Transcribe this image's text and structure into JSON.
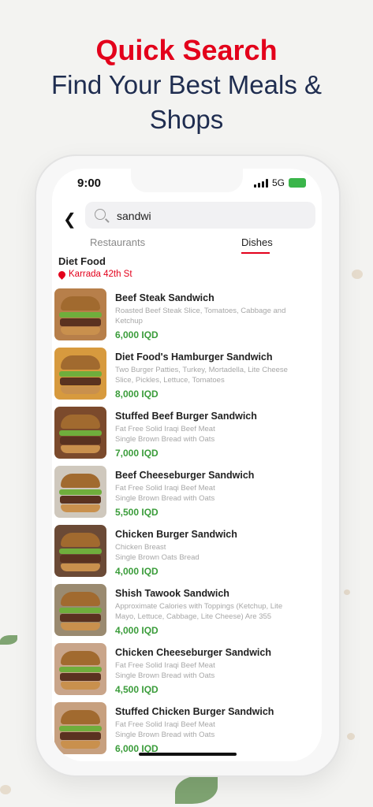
{
  "headline": {
    "accent": "Quick Search",
    "line1": "Find Your Best Meals &",
    "line2": "Shops"
  },
  "status_bar": {
    "time": "9:00",
    "network": "5G"
  },
  "search": {
    "value": "sandwi"
  },
  "tabs": [
    {
      "label": "Restaurants",
      "active": false
    },
    {
      "label": "Dishes",
      "active": true
    }
  ],
  "restaurant": {
    "name": "Diet Food",
    "location": "Karrada 42th St"
  },
  "items": [
    {
      "name": "Beef Steak Sandwich",
      "desc1": "Roasted Beef Steak Slice, Tomatoes, Cabbage and",
      "desc2": "Ketchup",
      "price": "6,000 IQD",
      "color": "#b77f4a"
    },
    {
      "name": "Diet Food's Hamburger Sandwich",
      "desc1": "Two Burger Patties, Turkey, Mortadella, Lite Cheese",
      "desc2": "Slice, Pickles, Lettuce, Tomatoes",
      "price": "8,000 IQD",
      "color": "#d79a3e"
    },
    {
      "name": "Stuffed Beef Burger Sandwich",
      "desc1": "Fat Free Solid Iraqi Beef Meat",
      "desc2": "Single Brown Bread with Oats",
      "price": "7,000 IQD",
      "color": "#7b4a2c"
    },
    {
      "name": "Beef Cheeseburger Sandwich",
      "desc1": "Fat Free Solid Iraqi Beef Meat",
      "desc2": "Single Brown Bread with Oats",
      "price": "5,500 IQD",
      "color": "#cfc8bd"
    },
    {
      "name": "Chicken Burger Sandwich",
      "desc1": "Chicken Breast",
      "desc2": "Single Brown Oats Bread",
      "price": "4,000 IQD",
      "color": "#6b4a36"
    },
    {
      "name": "Shish Tawook Sandwich",
      "desc1": "Approximate Calories with Toppings (Ketchup, Lite",
      "desc2": "Mayo, Lettuce, Cabbage, Lite Cheese) Are 355",
      "price": "4,000 IQD",
      "color": "#9a8a70"
    },
    {
      "name": "Chicken Cheeseburger Sandwich",
      "desc1": "Fat Free Solid Iraqi Beef Meat",
      "desc2": "Single Brown Bread with Oats",
      "price": "4,500 IQD",
      "color": "#c9a58a"
    },
    {
      "name": "Stuffed Chicken Burger Sandwich",
      "desc1": "Fat Free Solid Iraqi Beef Meat",
      "desc2": "Single Brown Bread with Oats",
      "price": "6,000 IQD",
      "color": "#c7a07f"
    }
  ]
}
